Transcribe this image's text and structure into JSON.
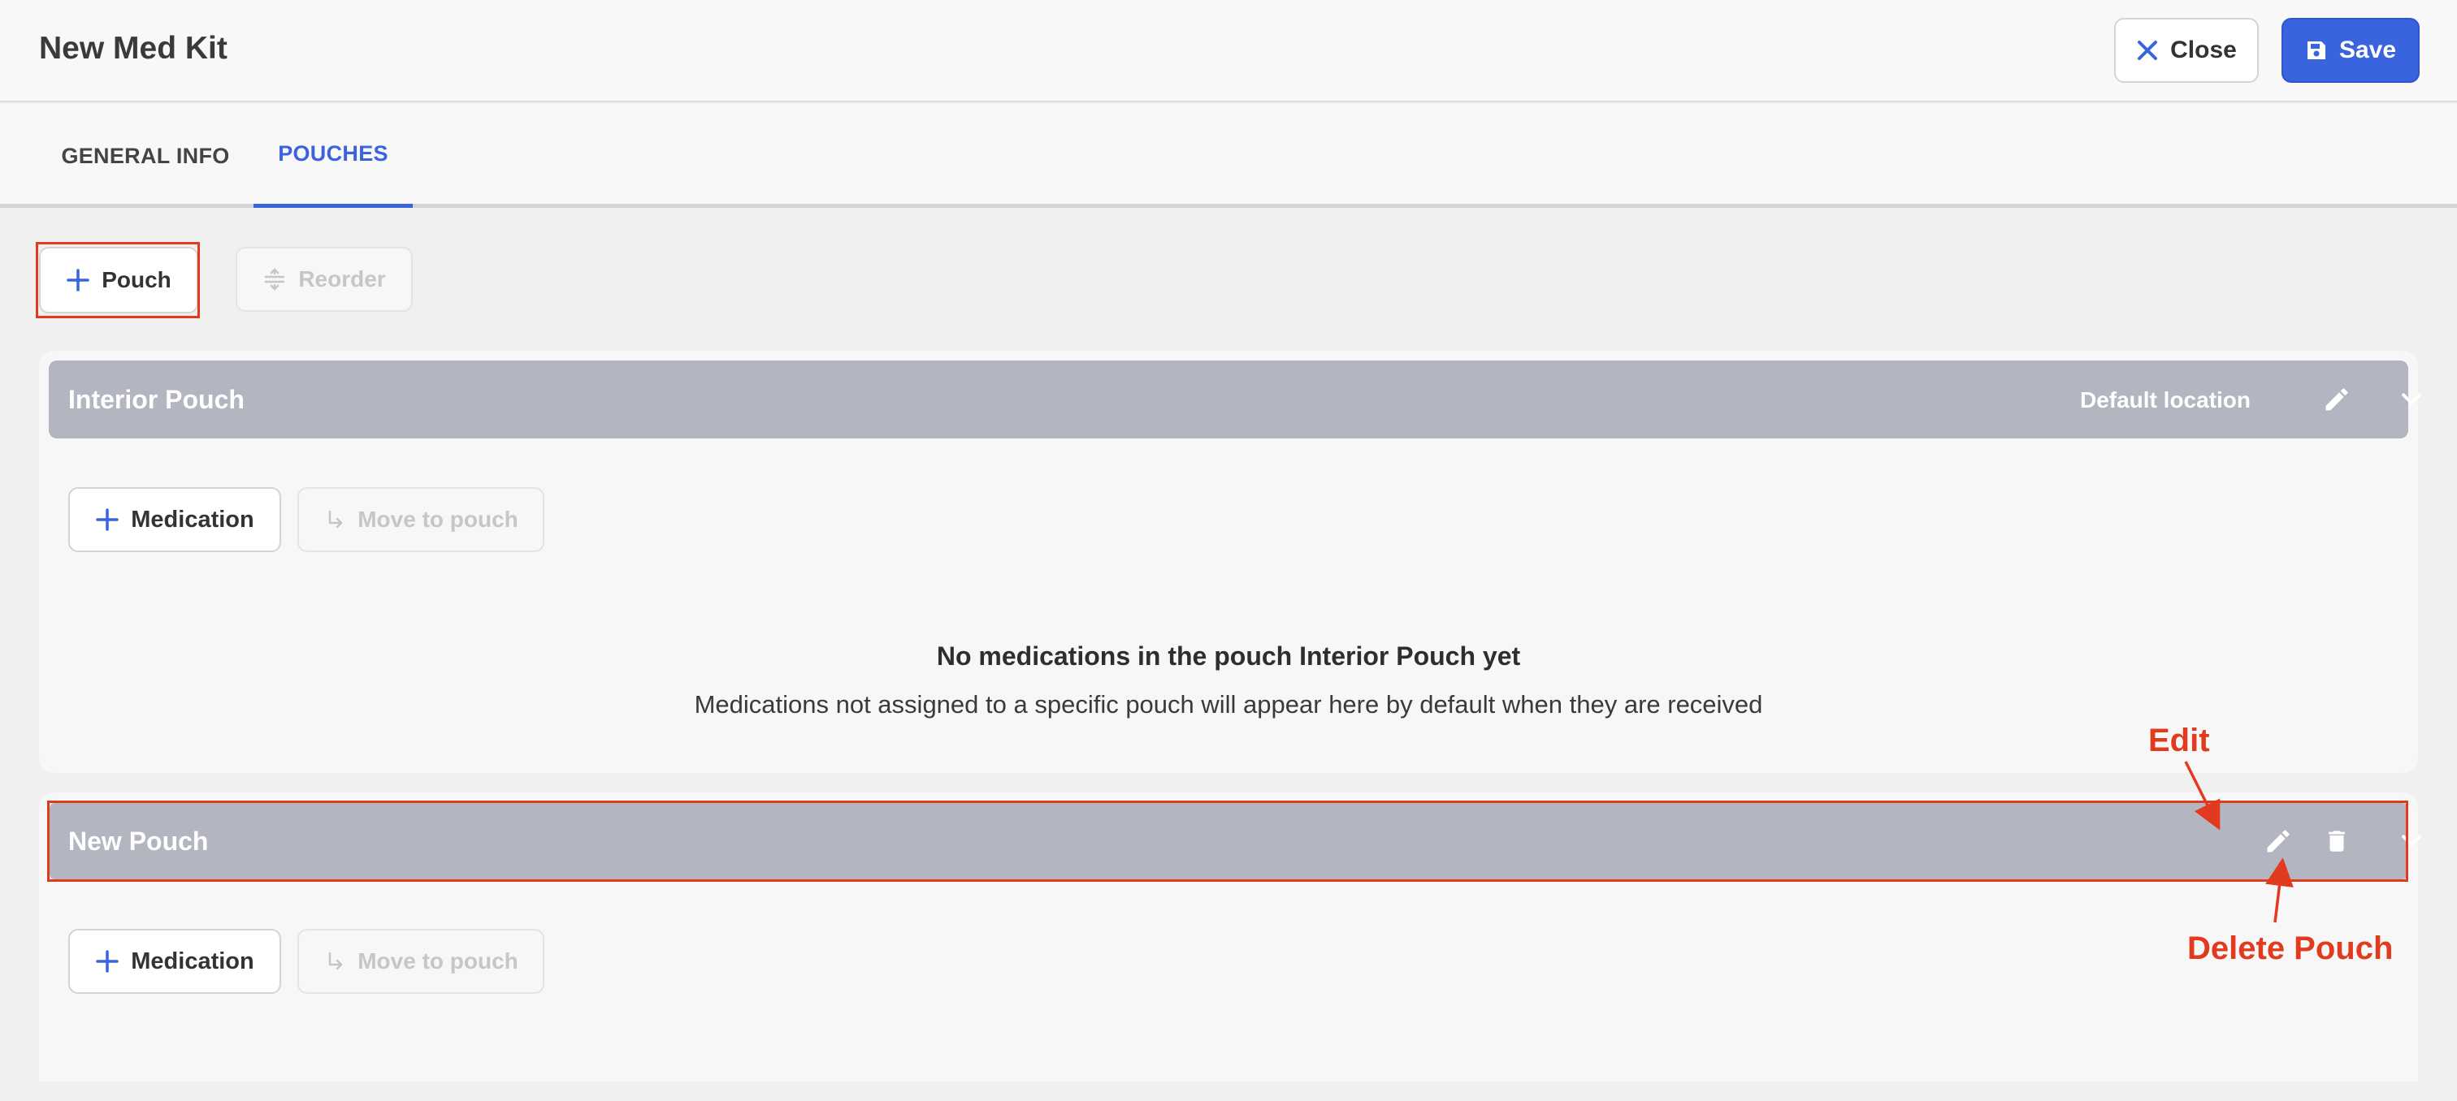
{
  "header": {
    "title": "New Med Kit",
    "close_label": "Close",
    "save_label": "Save"
  },
  "tabs": [
    {
      "label": "GENERAL INFO",
      "active": false
    },
    {
      "label": "POUCHES",
      "active": true
    }
  ],
  "toolbar": {
    "add_pouch_label": "Pouch",
    "reorder_label": "Reorder"
  },
  "pouches": [
    {
      "name": "Interior Pouch",
      "location_label": "Default location",
      "add_medication_label": "Medication",
      "move_to_pouch_label": "Move to pouch",
      "empty_title": "No medications in the pouch Interior Pouch yet",
      "empty_description": "Medications not assigned to a specific pouch will appear here by default when they are received"
    },
    {
      "name": "New Pouch",
      "add_medication_label": "Medication",
      "move_to_pouch_label": "Move to pouch"
    }
  ],
  "annotations": {
    "edit": "Edit",
    "delete": "Delete Pouch"
  },
  "colors": {
    "accent": "#3a63de",
    "pouch_header": "#b3b5c0",
    "annotation": "#e23a1e"
  },
  "icons": {
    "close": "close-icon",
    "save": "save-icon",
    "add": "plus-icon",
    "reorder": "reorder-icon",
    "edit": "pencil-icon",
    "delete": "trash-icon",
    "expand": "chevron-down-icon",
    "move": "move-arrow-icon"
  }
}
